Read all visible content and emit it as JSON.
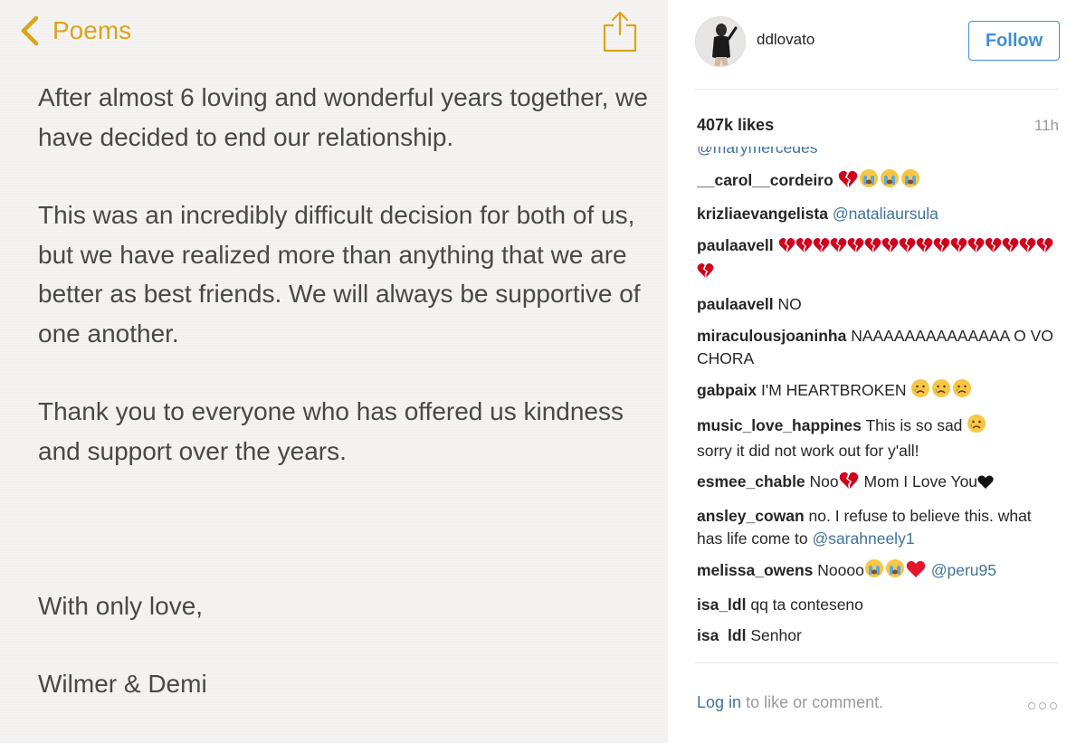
{
  "notes": {
    "back_label": "Poems",
    "paragraph1": "After almost 6 loving and wonderful years together, we have decided to end our relationship.",
    "paragraph2": "This was an incredibly difficult decision for both of us, but we have realized more than anything that we are better as best friends.  We will always be supportive of one another.",
    "paragraph3": "Thank you to everyone who has offered us kindness and support over the years.",
    "closing": "With only love,",
    "signature": "Wilmer & Demi",
    "accent_color": "#d9a51a"
  },
  "instagram": {
    "username": "ddlovato",
    "follow_label": "Follow",
    "likes": "407k likes",
    "time": "11h",
    "partial_mention": "@marymercedes",
    "comments": [
      {
        "user": "__carol__cordeiro",
        "text": "",
        "mention": ""
      },
      {
        "user": "krizliaevangelista",
        "text": "",
        "mention": "@nataliaursula"
      },
      {
        "user": "paulaavell",
        "text": "",
        "mention": ""
      },
      {
        "user": "paulaavell",
        "text": "NO",
        "mention": ""
      },
      {
        "user": "miraculousjoaninha",
        "text": "NAAAAAAAAAAAAAA O VO CHORA",
        "mention": ""
      },
      {
        "user": "gabpaix",
        "text": "I'M HEARTBROKEN",
        "mention": ""
      },
      {
        "user": "music_love_happines",
        "text": "This is so sad",
        "text2": "sorry it did not work out for y'all!",
        "mention": ""
      },
      {
        "user": "esmee_chable",
        "text": "Noo",
        "text2": "Mom I Love You",
        "mention": ""
      },
      {
        "user": "ansley_cowan",
        "text": "no. I refuse to believe this. what has life come to",
        "mention": "@sarahneely1"
      },
      {
        "user": "melissa_owens",
        "text": "Noooo",
        "mention": "@peru95"
      },
      {
        "user": "isa_ldl",
        "text": "qq ta conteseno",
        "mention": ""
      },
      {
        "user": "isa_ldl",
        "text": "Senhor",
        "mention": ""
      }
    ],
    "footer": {
      "login_label": "Log in",
      "footer_text": "to like or comment."
    },
    "icons": [
      "back-chevron-icon",
      "share-icon",
      "avatar",
      "broken-heart-icon",
      "crying-face-icon",
      "sad-face-icon",
      "red-heart-icon",
      "black-heart-icon",
      "more-options-icon"
    ],
    "link_color": "#3f729b",
    "follow_color": "#3f8fd6"
  }
}
